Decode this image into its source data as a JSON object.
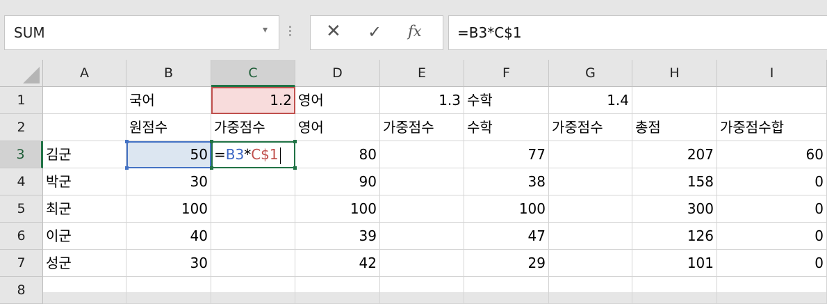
{
  "name_box": {
    "value": "SUM",
    "dropdown_icon": "chevron-down-icon"
  },
  "formula_bar": {
    "cancel_icon": "close-icon",
    "enter_icon": "check-icon",
    "fx_label": "fx",
    "formula": "=B3*C$1"
  },
  "columns": [
    "A",
    "B",
    "C",
    "D",
    "E",
    "F",
    "G",
    "H",
    "I"
  ],
  "rows": [
    "1",
    "2",
    "3",
    "4",
    "5",
    "6",
    "7",
    "8"
  ],
  "selected_column": "C",
  "selected_row": "3",
  "cells": {
    "B1": "국어",
    "C1": "1.2",
    "D1": "영어",
    "E1": "1.3",
    "F1": "수학",
    "G1": "1.4",
    "B2": "원점수",
    "C2": "가중점수",
    "D2": "영어",
    "E2": "가중점수",
    "F2": "수학",
    "G2": "가중점수",
    "H2": "총점",
    "I2": "가중점수합",
    "A3": "김군",
    "B3": "50",
    "D3": "80",
    "F3": "77",
    "H3": "207",
    "I3": "60",
    "A4": "박군",
    "B4": "30",
    "D4": "90",
    "F4": "38",
    "H4": "158",
    "I4": "0",
    "A5": "최군",
    "B5": "100",
    "D5": "100",
    "F5": "100",
    "H5": "300",
    "I5": "0",
    "A6": "이군",
    "B6": "40",
    "D6": "39",
    "F6": "47",
    "H6": "126",
    "I6": "0",
    "A7": "성군",
    "B7": "30",
    "D7": "42",
    "F7": "29",
    "H7": "101",
    "I7": "0"
  },
  "editing_cell": {
    "address": "C3",
    "parts": [
      "=",
      "B3",
      "*",
      "C$1"
    ]
  },
  "colors": {
    "excel_green": "#217346",
    "ref_blue": "#4472c4",
    "ref_red": "#c0504d"
  }
}
